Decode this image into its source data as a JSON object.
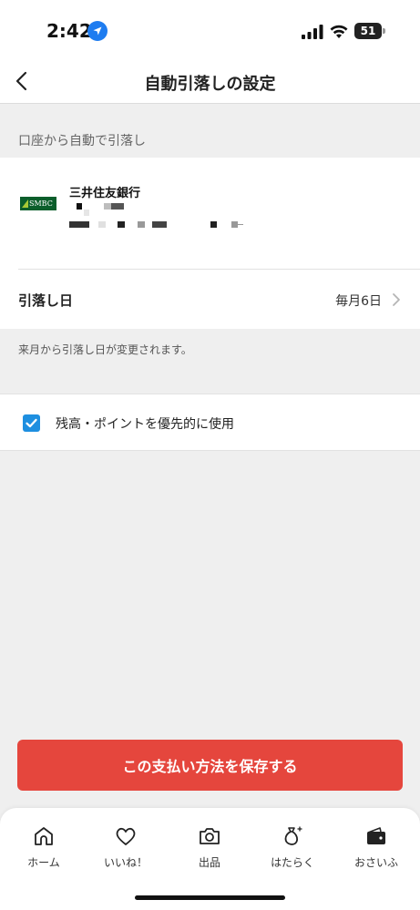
{
  "status_bar": {
    "time": "2:42",
    "battery": "51"
  },
  "header": {
    "title": "自動引落しの設定"
  },
  "section": {
    "caption": "口座から自動で引落し"
  },
  "bank": {
    "logo_text": "SMBC",
    "name": "三井住友銀行"
  },
  "withdrawal_day": {
    "label": "引落し日",
    "value": "毎月6日"
  },
  "notice": "来月から引落し日が変更されます。",
  "option": {
    "label": "残高・ポイントを優先的に使用",
    "checked": true
  },
  "save_button": {
    "label": "この支払い方法を保存する"
  },
  "colors": {
    "accent": "#e5463d",
    "checkbox": "#1e8fe0",
    "logo_green": "#0b5e2b"
  },
  "tabs": [
    {
      "label": "ホーム",
      "icon": "home-icon"
    },
    {
      "label": "いいね！",
      "icon": "heart-icon"
    },
    {
      "label": "出品",
      "icon": "camera-icon"
    },
    {
      "label": "はたらく",
      "icon": "money-bag-icon"
    },
    {
      "label": "おさいふ",
      "icon": "wallet-icon"
    }
  ]
}
